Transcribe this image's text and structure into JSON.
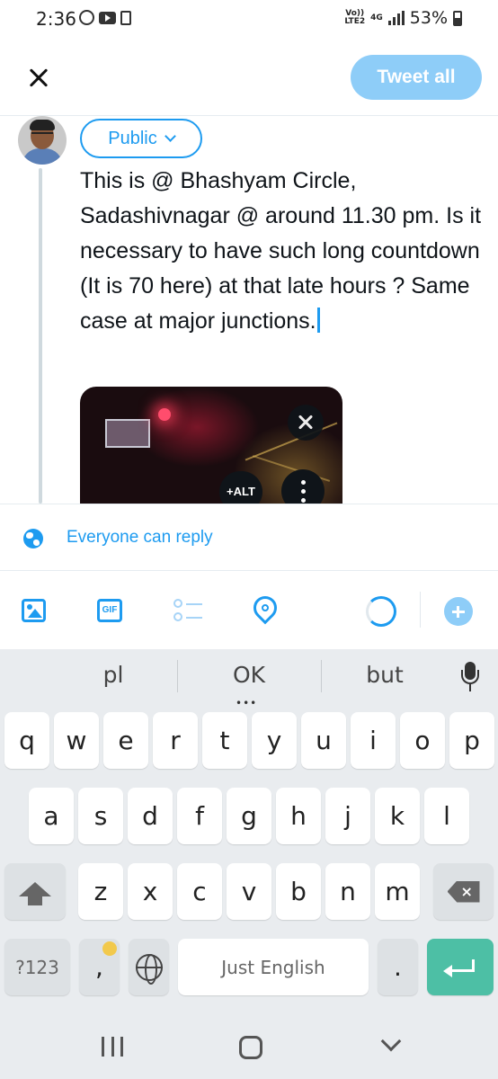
{
  "status_bar": {
    "time": "2:36",
    "volte": "Vo))\nLTE2",
    "network": "4G",
    "battery": "53%"
  },
  "header": {
    "tweet_all_label": "Tweet all"
  },
  "compose": {
    "audience_label": "Public",
    "tweet_text": "This is @ Bhashyam Circle, Sadashivnagar @ around 11.30 pm. Is it necessary to have such long countdown (It is 70 here) at that late hours ? Same case at major junctions.",
    "media": {
      "alt_label": "+ALT"
    }
  },
  "reply_settings": {
    "label": "Everyone can reply"
  },
  "toolbar": {
    "gif_label": "GIF",
    "icons": [
      "image-icon",
      "gif-icon",
      "poll-icon",
      "location-icon",
      "character-progress-icon",
      "add-tweet-icon"
    ]
  },
  "keyboard": {
    "suggestions": [
      "pl",
      "OK",
      "but"
    ],
    "rows": [
      [
        "q",
        "w",
        "e",
        "r",
        "t",
        "y",
        "u",
        "i",
        "o",
        "p"
      ],
      [
        "a",
        "s",
        "d",
        "f",
        "g",
        "h",
        "j",
        "k",
        "l"
      ],
      [
        "z",
        "x",
        "c",
        "v",
        "b",
        "n",
        "m"
      ]
    ],
    "symbols_label": "?123",
    "comma_label": ",",
    "space_label": "Just English",
    "period_label": "."
  },
  "colors": {
    "accent": "#1d9bf0",
    "tweet_button_disabled": "#8ecdf8",
    "enter_key": "#4dbfa5"
  }
}
